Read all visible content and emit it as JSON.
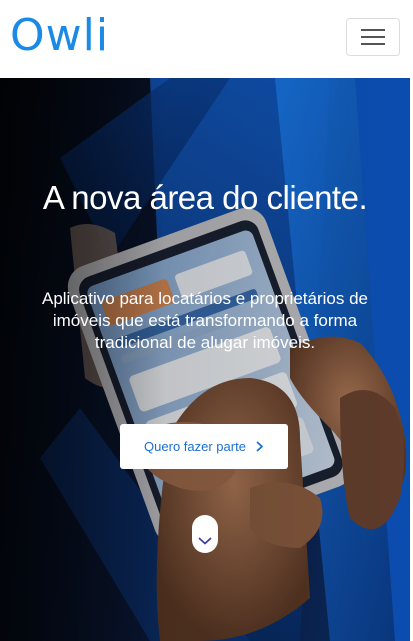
{
  "brand": {
    "name": "Owli",
    "color": "#1a8ae6"
  },
  "nav": {
    "toggle_icon": "hamburger-menu-icon"
  },
  "hero": {
    "title": "A nova área do cliente.",
    "subtitle": "Aplicativo para locatários e proprietários de imóveis que está transformando a forma tradicional de alugar imóveis.",
    "cta_label": "Quero fazer parte",
    "cta_icon": "chevron-right-icon",
    "scroll_icon": "chevron-down-icon",
    "accent_color": "#1a6fd6"
  }
}
